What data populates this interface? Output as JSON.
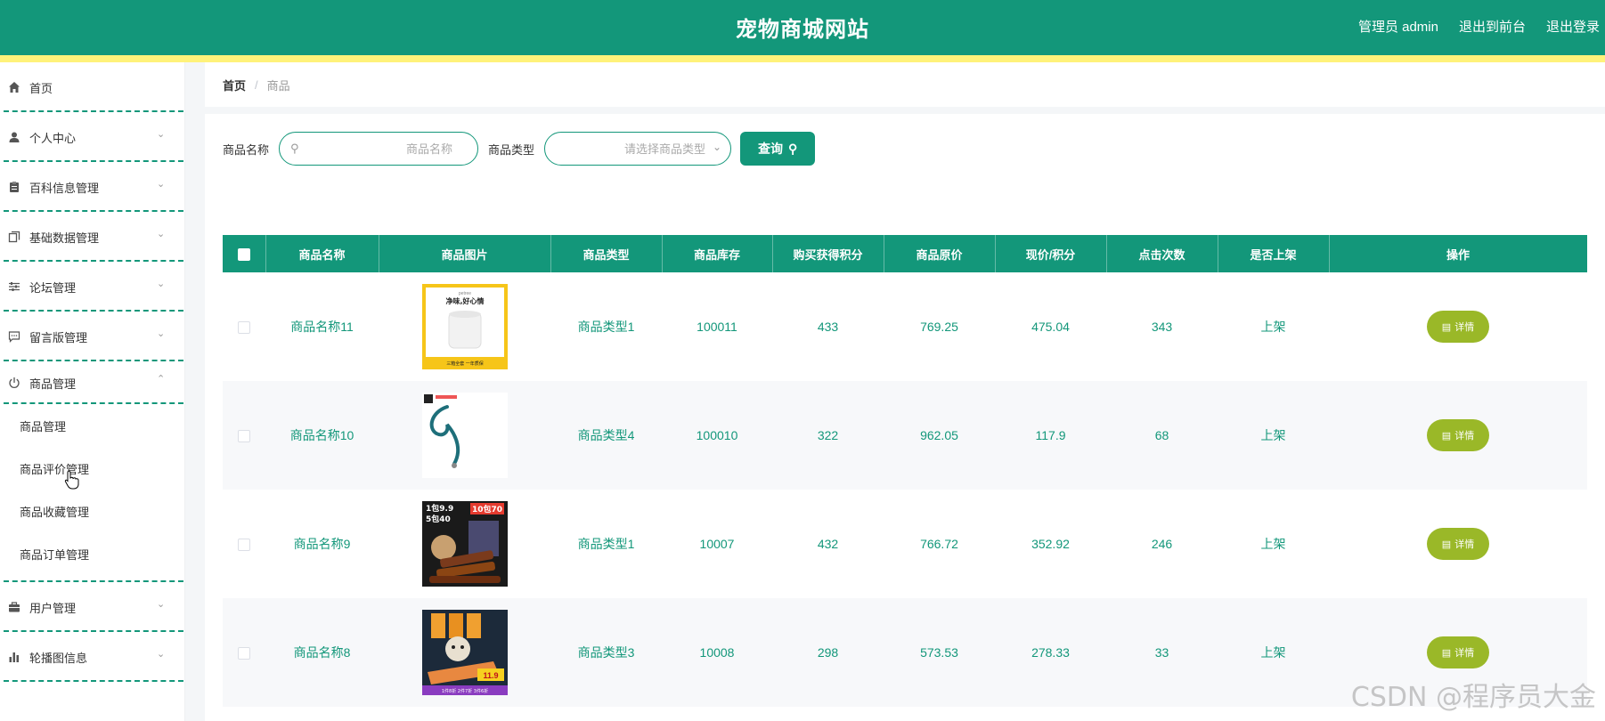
{
  "header": {
    "title": "宠物商城网站",
    "admin_label": "管理员 admin",
    "to_front": "退出到前台",
    "logout": "退出登录"
  },
  "sidebar": {
    "items": [
      {
        "label": "首页",
        "icon": "home-icon"
      },
      {
        "label": "个人中心",
        "icon": "user-icon"
      },
      {
        "label": "百科信息管理",
        "icon": "clipboard-icon"
      },
      {
        "label": "基础数据管理",
        "icon": "copy-icon"
      },
      {
        "label": "论坛管理",
        "icon": "sliders-icon"
      },
      {
        "label": "留言版管理",
        "icon": "message-icon"
      },
      {
        "label": "商品管理",
        "icon": "power-icon"
      },
      {
        "label": "用户管理",
        "icon": "briefcase-icon"
      },
      {
        "label": "轮播图信息",
        "icon": "bar-chart-icon"
      }
    ],
    "submenu": [
      "商品管理",
      "商品评价管理",
      "商品收藏管理",
      "商品订单管理"
    ]
  },
  "breadcrumb": {
    "home": "首页",
    "separator": "/",
    "current": "商品"
  },
  "search": {
    "name_label": "商品名称",
    "name_placeholder": "商品名称",
    "type_label": "商品类型",
    "type_placeholder": "请选择商品类型",
    "button": "查询"
  },
  "table": {
    "columns": [
      "商品名称",
      "商品图片",
      "商品类型",
      "商品库存",
      "购买获得积分",
      "商品原价",
      "现价/积分",
      "点击次数",
      "是否上架",
      "操作"
    ],
    "detail_label": "详情",
    "rows": [
      {
        "name": "商品名称11",
        "type": "商品类型1",
        "stock": "100011",
        "points": "433",
        "orig_price": "769.25",
        "price": "475.04",
        "clicks": "343",
        "status": "上架",
        "image": {
          "type": "white-product",
          "brand": "petree",
          "slogan": "净味,好心情",
          "footer": "三箱全套 一年质保"
        }
      },
      {
        "name": "商品名称10",
        "type": "商品类型4",
        "stock": "100010",
        "points": "322",
        "orig_price": "962.05",
        "price": "117.9",
        "clicks": "68",
        "status": "上架",
        "image": {
          "type": "leash"
        }
      },
      {
        "name": "商品名称9",
        "type": "商品类型1",
        "stock": "10007",
        "points": "432",
        "orig_price": "766.72",
        "price": "352.92",
        "clicks": "246",
        "status": "上架",
        "image": {
          "type": "dog-treats",
          "promo1": "1包9.9",
          "promo2": "10包70",
          "promo3": "5包40"
        }
      },
      {
        "name": "商品名称8",
        "type": "商品类型3",
        "stock": "10008",
        "points": "298",
        "orig_price": "573.53",
        "price": "278.33",
        "clicks": "33",
        "status": "上架",
        "image": {
          "type": "dog-food",
          "price_tag": "11.9",
          "footer": "1件8折 2件7折 3件6折"
        }
      }
    ]
  },
  "watermark": "CSDN @程序员大金",
  "colors": {
    "primary": "#13977a",
    "stripe": "#fff27a",
    "detail": "#9ab828"
  }
}
